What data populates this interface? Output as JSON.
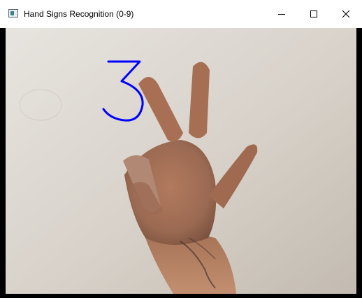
{
  "window": {
    "title": "Hand Signs Recognition (0-9)",
    "icon": "app-window-icon",
    "controls": {
      "minimize_icon": "minimize-icon",
      "maximize_icon": "maximize-icon",
      "close_icon": "close-icon"
    }
  },
  "camera_view": {
    "predicted_digit": "3",
    "prediction_color": "#0000ff",
    "background_color": "#d8d2ca"
  }
}
